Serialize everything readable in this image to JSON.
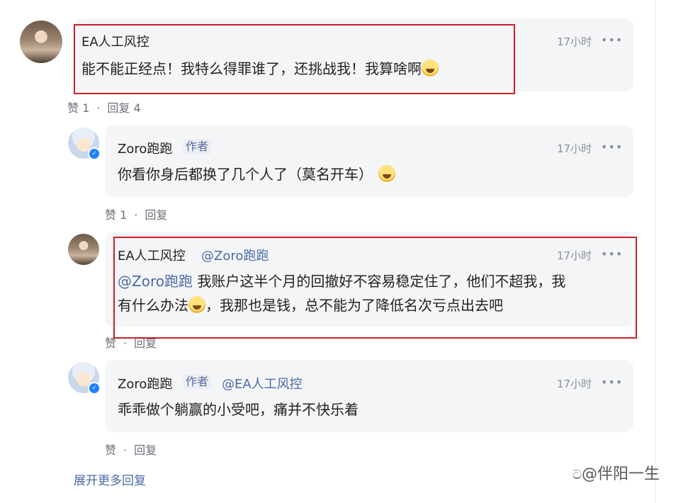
{
  "comments": [
    {
      "author": "EA人工风控",
      "time": "17小时",
      "text": "能不能正经点！我特么得罪谁了，还挑战我！我算啥啊",
      "likes_label": "赞 1",
      "reply_label": "回复 4"
    },
    {
      "author": "Zoro跑跑",
      "author_tag": "作者",
      "time": "17小时",
      "text": "你看你身后都换了几个人了（莫名开车）",
      "likes_label": "赞 1",
      "reply_label": "回复"
    },
    {
      "author": "EA人工风控",
      "reply_to": "@Zoro跑跑",
      "time": "17小时",
      "mention": "@Zoro跑跑",
      "text_line1": " 我账户这半个月的回撤好不容易稳定住了，他们不超我，我",
      "text_line2_a": "有什么办法",
      "text_line2_b": "，我那也是钱，总不能为了降低名次亏点出去吧",
      "likes_label": "赞",
      "reply_label": "回复"
    },
    {
      "author": "Zoro跑跑",
      "author_tag": "作者",
      "reply_to": "@EA人工风控",
      "time": "17小时",
      "text": "乖乖做个躺赢的小受吧，痛并不快乐着",
      "likes_label": "赞",
      "reply_label": "回复"
    }
  ],
  "more_icon": "more-horizontal-icon",
  "separator": "·",
  "expand_label": "展开更多回复",
  "watermark": "@伴阳一生",
  "colors": {
    "highlight_border": "#c8202a",
    "mention": "#4a6ba5",
    "bubble_bg": "#f4f5f7"
  }
}
